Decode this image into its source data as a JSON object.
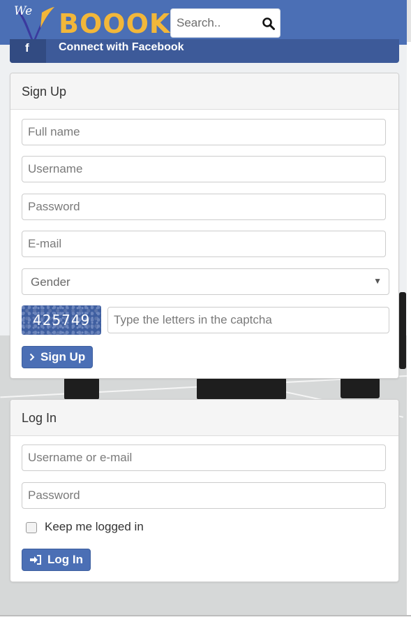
{
  "header": {
    "logo_we": "We",
    "logo_book": "BOOOK",
    "search_placeholder": "Search..",
    "search_icon": "search-icon"
  },
  "facebook": {
    "icon": "f",
    "label": "Connect with Facebook"
  },
  "signup": {
    "title": "Sign Up",
    "full_name_placeholder": "Full name",
    "username_placeholder": "Username",
    "password_placeholder": "Password",
    "email_placeholder": "E-mail",
    "gender_value": "Gender",
    "captcha_code": "425749",
    "captcha_placeholder": "Type the letters in the captcha",
    "button_label": "Sign Up",
    "button_icon": "chevron-right-icon"
  },
  "login": {
    "title": "Log In",
    "username_placeholder": "Username or e-mail",
    "password_placeholder": "Password",
    "keep_logged_in_label": "Keep me logged in",
    "keep_logged_in_checked": false,
    "button_label": "Log In",
    "button_icon": "sign-in-icon"
  },
  "colors": {
    "header_bg": "#4b6fb5",
    "facebook_bg": "#3d5a99",
    "button_bg": "#4b6fb5",
    "logo_accent": "#f2b73a"
  }
}
